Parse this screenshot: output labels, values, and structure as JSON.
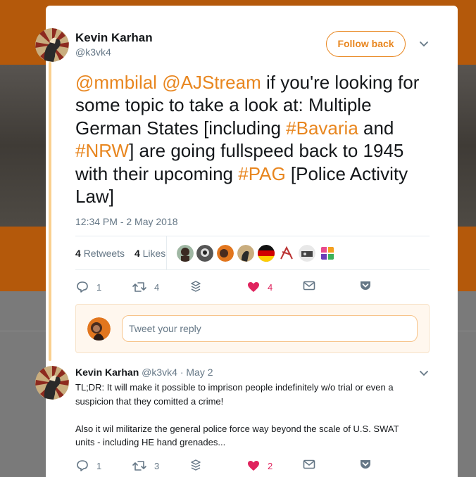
{
  "tweet": {
    "author_name": "Kevin Karhan",
    "author_handle": "@k3vk4",
    "follow_label": "Follow back",
    "text_parts": [
      {
        "text": "@mmbilal",
        "link": true
      },
      {
        "text": " ",
        "link": false
      },
      {
        "text": "@AJStream",
        "link": true
      },
      {
        "text": " if you're looking for some topic to take a look at: Multiple German States [including ",
        "link": false
      },
      {
        "text": "#Bavaria",
        "link": true
      },
      {
        "text": " and ",
        "link": false
      },
      {
        "text": "#NRW",
        "link": true
      },
      {
        "text": "] are going fullspeed back to 1945 with their upcoming ",
        "link": false
      },
      {
        "text": "#PAG",
        "link": true
      },
      {
        "text": " [Police Activity Law]",
        "link": false
      }
    ],
    "timestamp": "12:34 PM - 2 May 2018",
    "retweets_count": "4",
    "retweets_label": "Retweets",
    "likes_count": "4",
    "likes_label": "Likes",
    "liker_avatars": [
      "liker-avatar-1",
      "liker-avatar-2",
      "liker-avatar-3",
      "liker-avatar-4",
      "liker-avatar-5",
      "liker-avatar-6",
      "liker-avatar-7",
      "liker-avatar-8"
    ],
    "actions": {
      "reply_count": "1",
      "retweet_count": "4",
      "like_count": "4"
    }
  },
  "reply_box": {
    "placeholder": "Tweet your reply"
  },
  "reply_tweet": {
    "author_name": "Kevin Karhan",
    "author_handle": "@k3vk4",
    "date": "· May 2",
    "text_line1": "TL;DR: It will make it possible to imprison people indefinitely w/o trial or even a suspicion that they comitted a crime!",
    "text_line2": "Also it wil militarize the general police force way beyond the scale of U.S. SWAT units - including HE hand grenades...",
    "actions": {
      "reply_count": "1",
      "retweet_count": "3",
      "like_count": "2"
    }
  },
  "colors": {
    "accent": "#e8861f",
    "like": "#e0245e",
    "text": "#14171a",
    "muted": "#657786"
  }
}
